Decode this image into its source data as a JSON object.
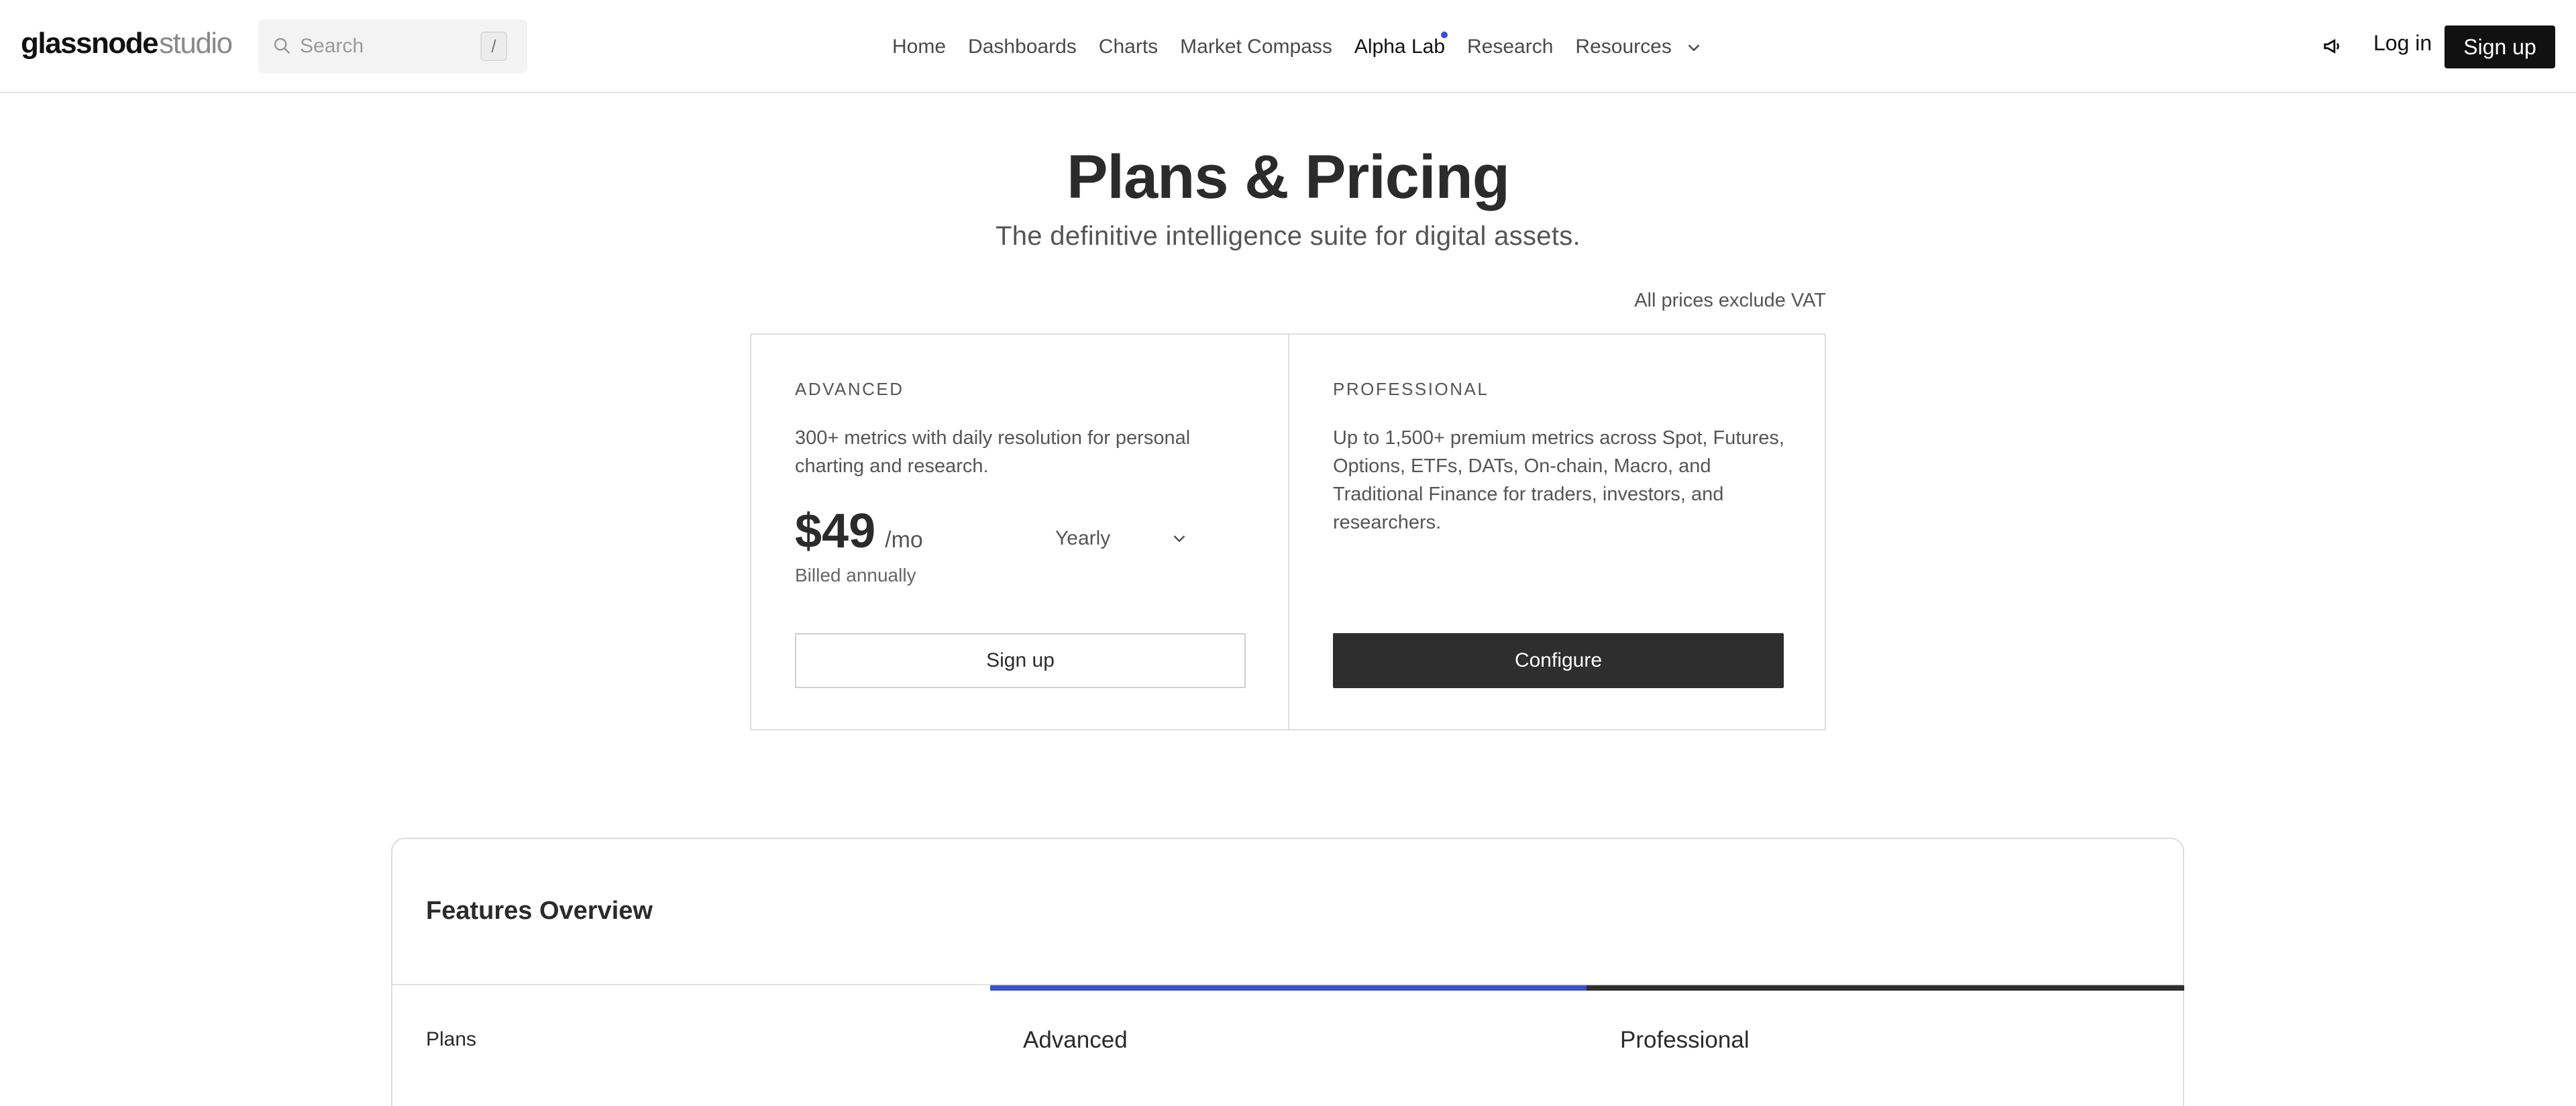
{
  "header": {
    "logo_brand": "glassnode",
    "logo_sub": "studio",
    "search_placeholder": "Search",
    "search_shortcut": "/",
    "nav": [
      {
        "label": "Home"
      },
      {
        "label": "Dashboards"
      },
      {
        "label": "Charts"
      },
      {
        "label": "Market Compass"
      },
      {
        "label": "Alpha Lab"
      },
      {
        "label": "Research"
      },
      {
        "label": "Resources"
      }
    ],
    "login_label": "Log in",
    "signup_label": "Sign up",
    "accent_color": "#3c4fd6",
    "icons": [
      "search-icon",
      "megaphone-icon",
      "chevron-down-icon"
    ]
  },
  "hero": {
    "title": "Plans & Pricing",
    "subtitle": "The definitive intelligence suite for digital assets.",
    "vat_note": "All prices exclude VAT"
  },
  "plans": {
    "advanced": {
      "tier": "ADVANCED",
      "description": "300+ metrics with daily resolution for personal charting and research.",
      "price": "$49",
      "period": "/mo",
      "billing_selected": "Yearly",
      "billed_note": "Billed annually",
      "cta": "Sign up"
    },
    "professional": {
      "tier": "PROFESSIONAL",
      "description": "Up to 1,500+ premium metrics across Spot, Futures, Options, ETFs, DATs, On-chain, Macro, and Traditional Finance for traders, investors, and researchers.",
      "cta": "Configure"
    }
  },
  "features": {
    "title": "Features Overview",
    "row_label": "Plans",
    "columns": [
      "Advanced",
      "Professional"
    ],
    "column_colors": [
      "#3c4fd6",
      "#2e2e2e"
    ]
  }
}
